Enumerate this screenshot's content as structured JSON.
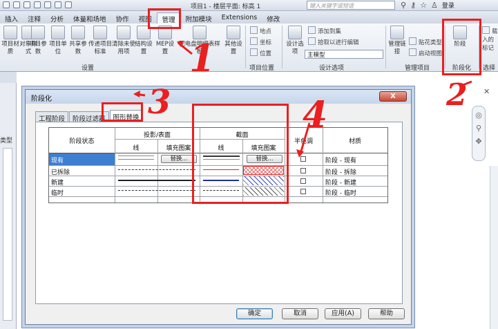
{
  "window": {
    "title": "项目1 - 楼层平面: 标高 1",
    "search_placeholder": "键入关键字或短语",
    "login": "登录"
  },
  "ribbon_tabs": [
    "插入",
    "注释",
    "分析",
    "体量和场地",
    "协作",
    "视图",
    "管理",
    "附加模块",
    "Extensions",
    "修改"
  ],
  "ribbon": {
    "buttons": [
      "项目材质",
      "对象样式",
      "项目参数",
      "项目单位",
      "共享参数",
      "传递项目标准",
      "清除未使用项",
      "结构设置",
      "MEP设置",
      "配电盘明细表样板",
      "其他设置",
      "阶段",
      "管理链接"
    ],
    "small_buttons": [
      "地点",
      "坐标",
      "位置",
      "设计选项",
      "添加到集",
      "拾取以进行编辑",
      "贴花类型",
      "启动视图",
      "载入的标记",
      "样式"
    ],
    "design_option_value": "主模型",
    "groups": [
      "设置",
      "项目位置",
      "设计选项",
      "管理项目",
      "阶段化",
      "选择"
    ]
  },
  "sidebar": {
    "label": "类型"
  },
  "dialog": {
    "title": "阶段化",
    "close_label": "X",
    "tabs": [
      "工程阶段",
      "阶段过滤器",
      "图形替换"
    ],
    "headers": {
      "phase_status": "阶段状态",
      "projection": "投影/表面",
      "cut": "截面",
      "line": "线",
      "fill": "填充图案",
      "halftone": "半色调",
      "material": "材质"
    },
    "override_button": "替换...",
    "rows": [
      {
        "status": "现有",
        "material": "阶段 - 现有"
      },
      {
        "status": "已拆除",
        "material": "阶段 - 拆除"
      },
      {
        "status": "新建",
        "material": "阶段 - 新建"
      },
      {
        "status": "临时",
        "material": "阶段 - 临时"
      }
    ],
    "buttons": {
      "ok": "确定",
      "cancel": "取消",
      "apply": "应用(A)",
      "help": "帮助"
    }
  },
  "annotations": [
    "1",
    "2",
    "3",
    "4"
  ]
}
